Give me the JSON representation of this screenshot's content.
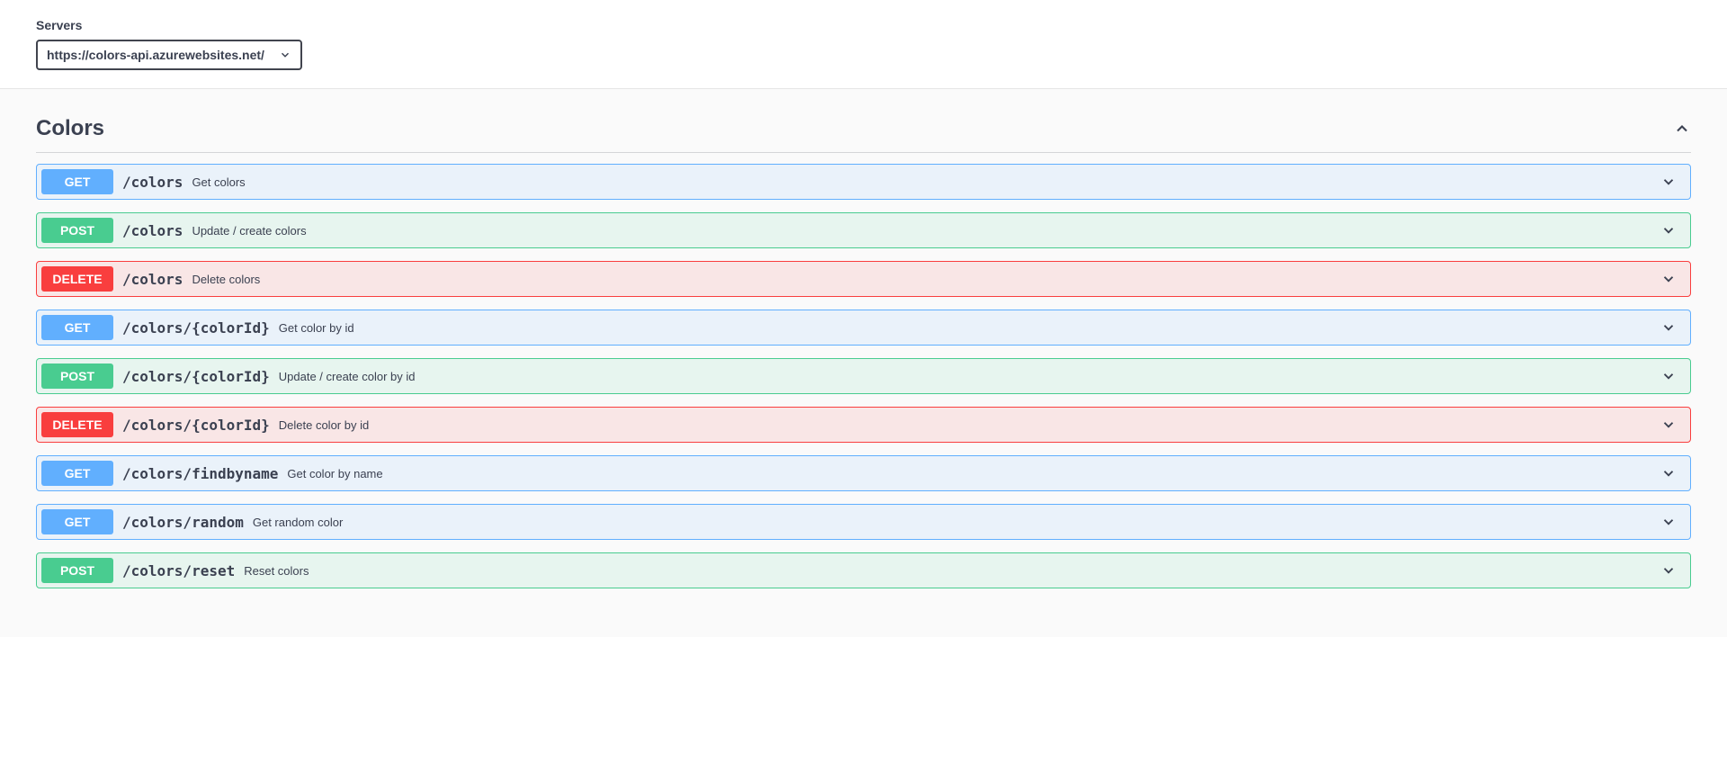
{
  "servers": {
    "label": "Servers",
    "selected": "https://colors-api.azurewebsites.net/"
  },
  "tag": {
    "name": "Colors"
  },
  "operations": [
    {
      "method": "GET",
      "path": "/colors",
      "summary": "Get colors"
    },
    {
      "method": "POST",
      "path": "/colors",
      "summary": "Update / create colors"
    },
    {
      "method": "DELETE",
      "path": "/colors",
      "summary": "Delete colors"
    },
    {
      "method": "GET",
      "path": "/colors/{colorId}",
      "summary": "Get color by id"
    },
    {
      "method": "POST",
      "path": "/colors/{colorId}",
      "summary": "Update / create color by id"
    },
    {
      "method": "DELETE",
      "path": "/colors/{colorId}",
      "summary": "Delete color by id"
    },
    {
      "method": "GET",
      "path": "/colors/findbyname",
      "summary": "Get color by name"
    },
    {
      "method": "GET",
      "path": "/colors/random",
      "summary": "Get random color"
    },
    {
      "method": "POST",
      "path": "/colors/reset",
      "summary": "Reset colors"
    }
  ]
}
